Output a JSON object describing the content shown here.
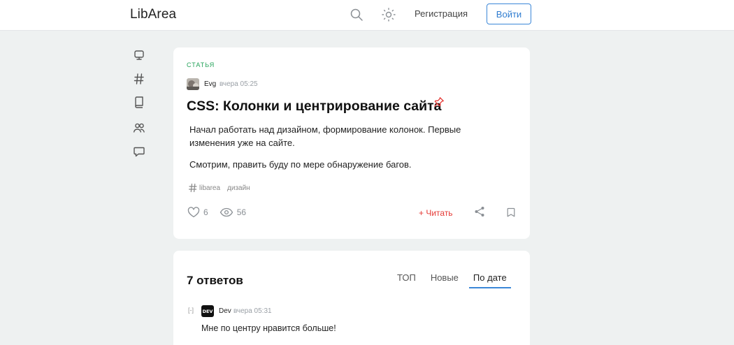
{
  "header": {
    "logo": "LibArea",
    "register_label": "Регистрация",
    "login_label": "Войти",
    "icons": [
      "search-icon",
      "sun-icon"
    ]
  },
  "sidebar": {
    "icons": [
      "monitor-icon",
      "hashtag-icon",
      "book-icon",
      "users-icon",
      "comment-icon"
    ]
  },
  "post": {
    "type": "СТАТЬЯ",
    "author": "Evg",
    "time": "вчера 05:25",
    "title": "CSS: Колонки и центрирование сайта",
    "paragraphs": [
      "Начал работать над дизайном, формирование колонок. Первые изменения уже на сайте.",
      "Смотрим, править буду по мере обнаружение багов."
    ],
    "tags": [
      "libarea",
      "дизайн"
    ],
    "likes": "6",
    "views": "56",
    "read_label": "+ Читать"
  },
  "answers": {
    "title": "7 ответов",
    "sort_tabs": [
      "ТОП",
      "Новые",
      "По дате"
    ],
    "active_tab": "По дате",
    "comment": {
      "toggle": "[-]",
      "avatar_text": "DEV",
      "author": "Dev",
      "time": "вчера 05:31",
      "text": "Мне по центру нравится больше!"
    }
  },
  "colors": {
    "accent": "#3b87d8",
    "post_type": "#25a35a",
    "read_link": "#e53935",
    "page_bg": "#eef1f1"
  }
}
